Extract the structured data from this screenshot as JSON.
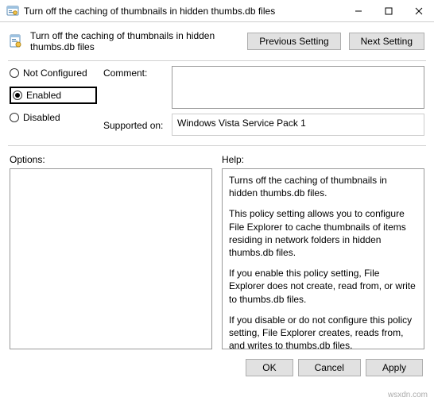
{
  "window": {
    "title": "Turn off the caching of thumbnails in hidden thumbs.db files"
  },
  "header": {
    "policy_title": "Turn off the caching of thumbnails in hidden thumbs.db files",
    "prev_btn": "Previous Setting",
    "next_btn": "Next Setting"
  },
  "radios": {
    "not_configured": "Not Configured",
    "enabled": "Enabled",
    "disabled": "Disabled",
    "selected": "enabled"
  },
  "info": {
    "comment_label": "Comment:",
    "comment_value": "",
    "supported_label": "Supported on:",
    "supported_value": "Windows Vista Service Pack 1"
  },
  "sections": {
    "options_label": "Options:",
    "help_label": "Help:"
  },
  "help": {
    "p1": "Turns off the caching of thumbnails in hidden thumbs.db files.",
    "p2": "This policy setting allows you to configure File Explorer to cache thumbnails of items residing in network folders in hidden thumbs.db files.",
    "p3": "If you enable this policy setting, File Explorer does not create, read from, or write to thumbs.db files.",
    "p4": "If you disable or do not configure this policy setting, File Explorer creates, reads from, and writes to thumbs.db files."
  },
  "buttons": {
    "ok": "OK",
    "cancel": "Cancel",
    "apply": "Apply"
  },
  "watermark": "wsxdn.com"
}
